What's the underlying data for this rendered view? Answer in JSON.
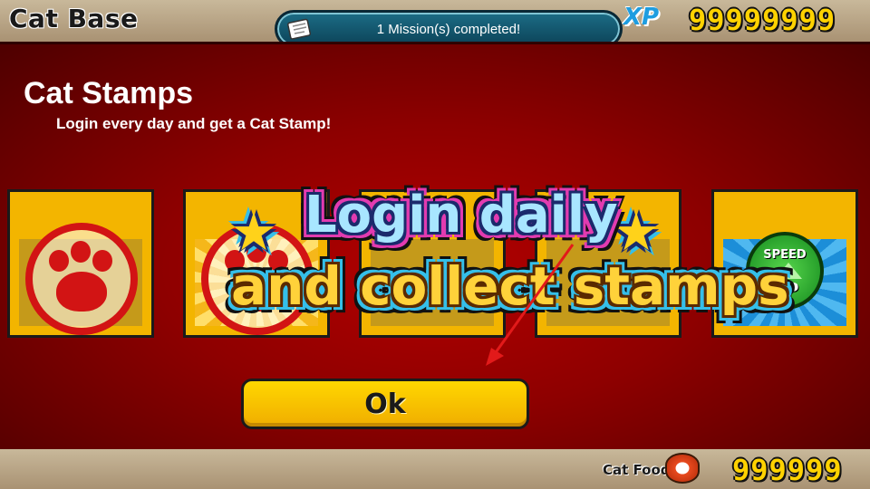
{
  "header": {
    "title": "Cat Base",
    "mission_text": "1 Mission(s) completed!",
    "xp_label": "XP",
    "xp_value": "99999999"
  },
  "panel": {
    "title": "Cat Stamps",
    "subtitle": "Login every day and get a Cat Stamp!",
    "speed_badge_top": "SPEED",
    "speed_badge_bottom": "UP"
  },
  "banner": {
    "line1": "Login daily",
    "line2": "and collect stamps"
  },
  "ok_button": {
    "label": "Ok"
  },
  "footer": {
    "food_label": "Cat Food",
    "food_value": "999999"
  },
  "colors": {
    "panel_red": "#b30000",
    "card_gold": "#f3b500",
    "stamp_red": "#d21414",
    "currency_yellow": "#ffd200",
    "mission_teal": "#1c6d86"
  }
}
